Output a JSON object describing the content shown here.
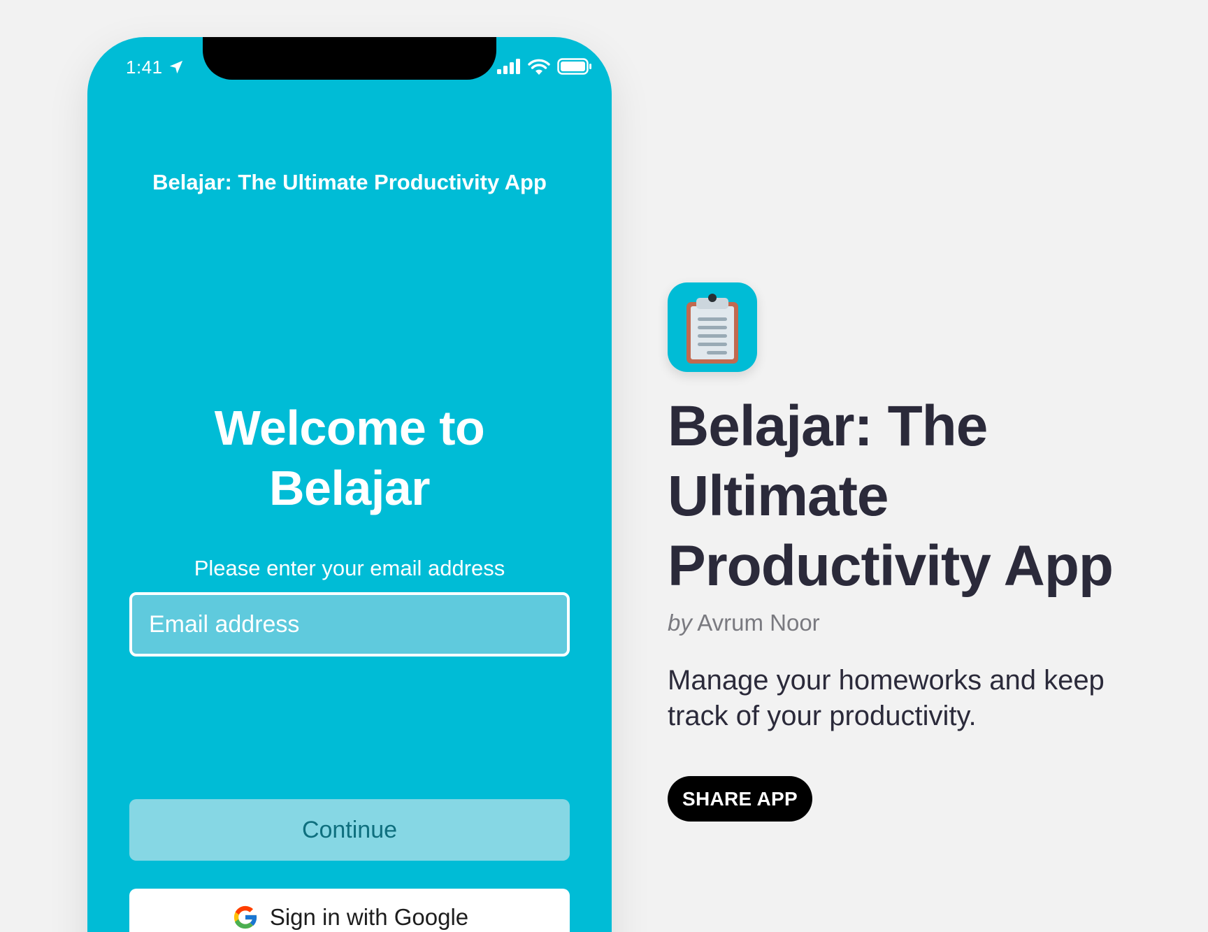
{
  "status_bar": {
    "time": "1:41"
  },
  "phone": {
    "header_title": "Belajar: The Ultimate Productivity App",
    "welcome_heading": "Welcome to Belajar",
    "subtitle": "Please enter your email address",
    "email_placeholder": "Email address",
    "continue_label": "Continue",
    "google_label": "Sign in with Google"
  },
  "info": {
    "app_title": "Belajar: The Ultimate Productivity App",
    "by_prefix": "by",
    "author": "Avrum Noor",
    "description": "Manage your homeworks and keep track of your productivity.",
    "share_label": "SHARE APP"
  },
  "colors": {
    "accent": "#00bcd6",
    "title_text": "#2b2a3a",
    "page_background": "#f2f2f2"
  },
  "icons": [
    "location-arrow-icon",
    "signal-bars-icon",
    "wifi-icon",
    "battery-icon",
    "google-logo-icon",
    "clipboard-app-icon"
  ]
}
